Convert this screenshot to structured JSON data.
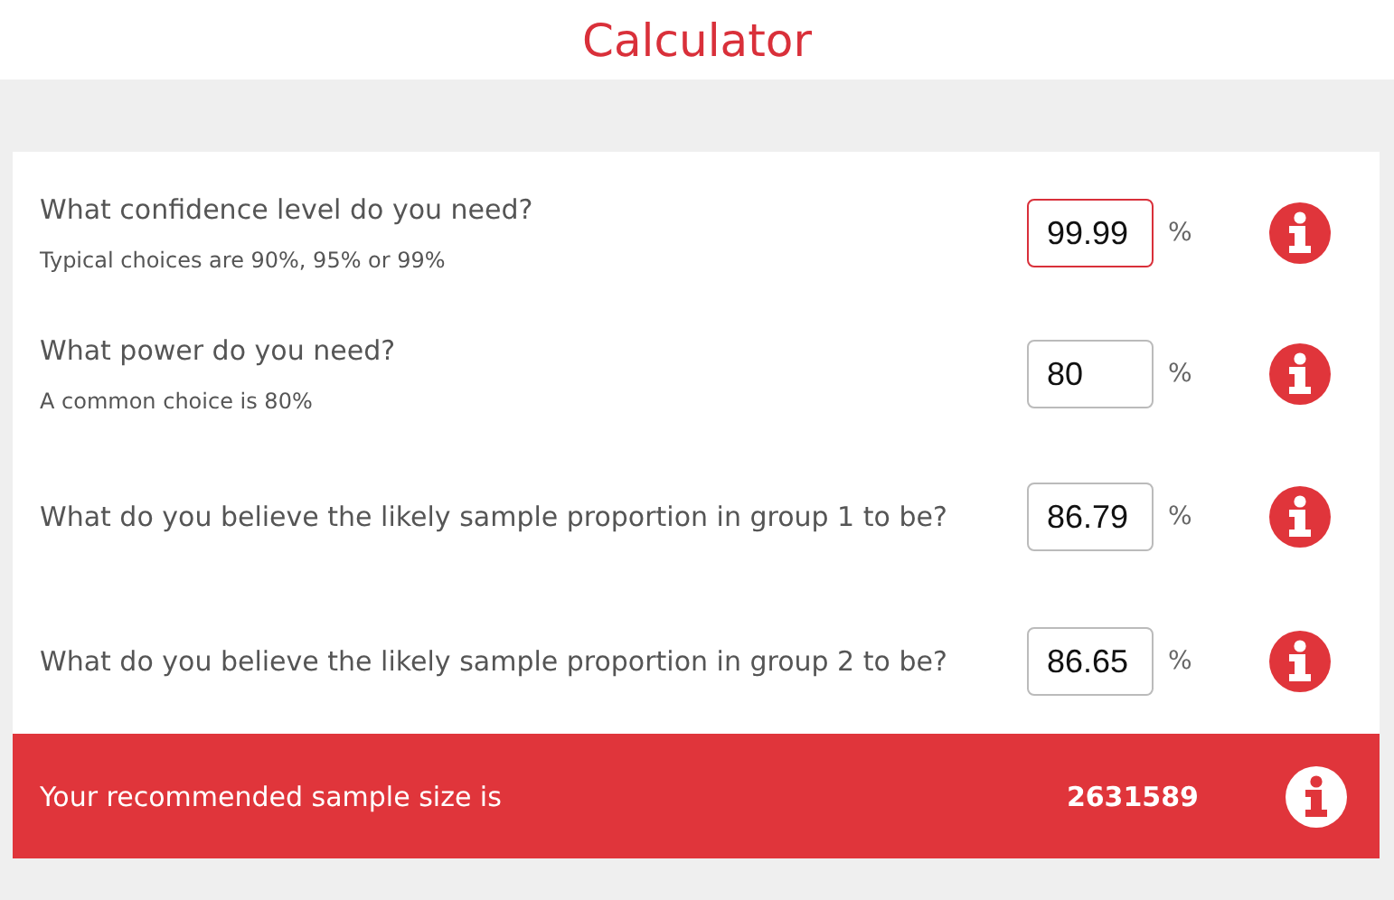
{
  "title": "Calculator",
  "questions": [
    {
      "label": "What confidence level do you need?",
      "hint": "Typical choices are 90%, 95% or 99%",
      "value": "99.99",
      "unit": "%",
      "focused": true
    },
    {
      "label": "What power do you need?",
      "hint": "A common choice is 80%",
      "value": "80",
      "unit": "%",
      "focused": false
    },
    {
      "label": "What do you believe the likely sample proportion in group 1 to be?",
      "value": "86.79",
      "unit": "%",
      "focused": false
    },
    {
      "label": "What do you believe the likely sample proportion in group 2 to be?",
      "value": "86.65",
      "unit": "%",
      "focused": false
    }
  ],
  "result": {
    "label": "Your recommended sample size is",
    "value": "2631589"
  }
}
